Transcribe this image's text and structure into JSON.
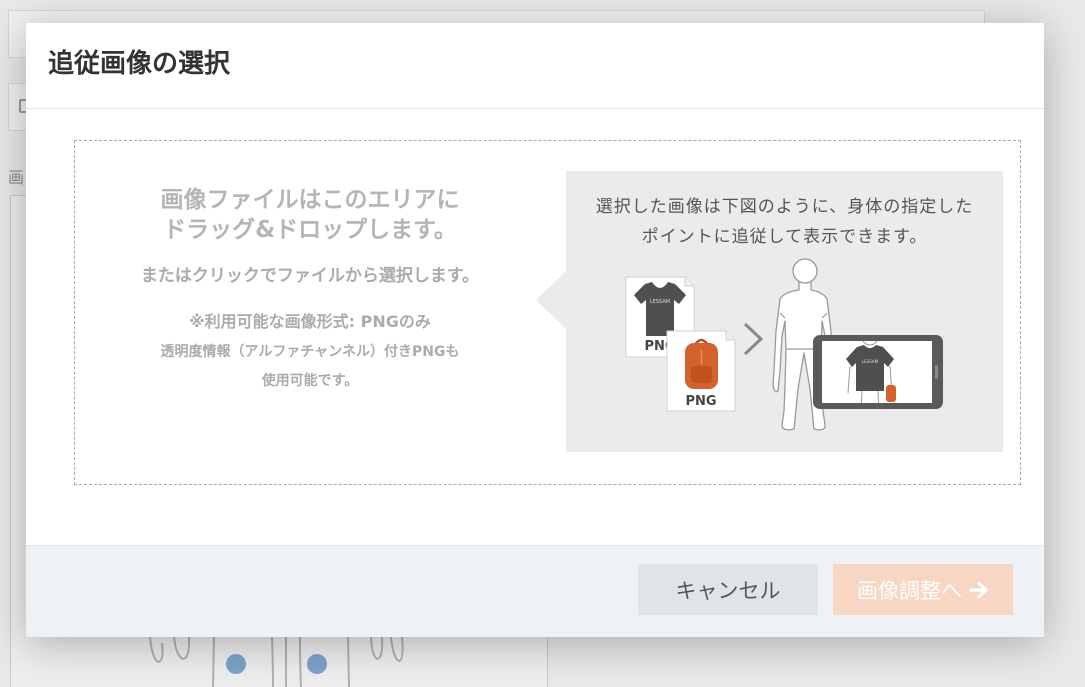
{
  "page": {
    "background": {
      "field_label": "画",
      "button_icon": "document-icon"
    }
  },
  "modal": {
    "title": "追従画像の選択",
    "dropzone": {
      "headline": [
        "画像ファイルはこのエリアに",
        "ドラッグ&ドロップします。"
      ],
      "subtext": "またはクリックでファイルから選択します。",
      "format_note": "※利用可能な画像形式: PNGのみ",
      "alpha_note": [
        "透明度情報（アルファチャンネル）付きPNGも",
        "使用可能です。"
      ]
    },
    "info_panel": {
      "description": [
        "選択した画像は下図のように、身体の指定した",
        "ポイントに追従して表示できます。"
      ],
      "cards": [
        {
          "label": "PNG",
          "icon": "tshirt-icon"
        },
        {
          "label": "PNG",
          "icon": "backpack-icon"
        }
      ],
      "shirt_logo": "LESSAM",
      "arrow_icon": "chevron-right-icon",
      "device_icon": "tablet-icon"
    },
    "footer": {
      "cancel_label": "キャンセル",
      "next_label": "画像調整へ",
      "next_icon": "arrow-right-icon"
    }
  },
  "colors": {
    "next_button_bg": "#f7d6c3",
    "cancel_button_bg": "#e1e4e7",
    "footer_bg": "#eef1f5",
    "info_panel_bg": "#ebebeb",
    "backpack": "#d4622c",
    "tracking_point": "#7ea3cc"
  }
}
